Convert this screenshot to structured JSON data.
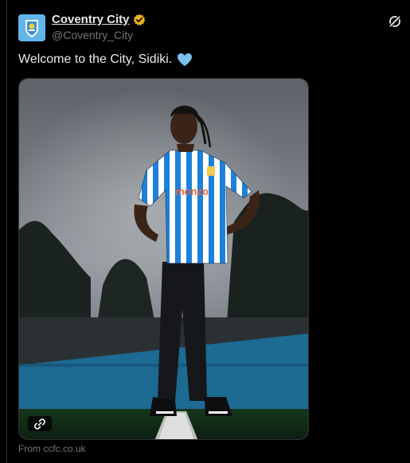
{
  "tweet": {
    "author": {
      "display_name": "Coventry City",
      "handle": "@Coventry_City",
      "verified_badge": "gold-check-badge",
      "avatar": "coventry-city-crest"
    },
    "text": "Welcome to the City, Sidiki.",
    "emoji": "light-blue-heart",
    "media": {
      "description_icon": "link-icon",
      "shirt_sponsor": "monzo"
    },
    "source": "From ccfc.co.uk",
    "action_icon": "grok-icon"
  },
  "colors": {
    "background": "#000000",
    "text_primary": "#e7e9ea",
    "text_secondary": "#71767b",
    "accent_sky_blue": "#1e9be0",
    "heart": "#79bff0",
    "verified": "#e8b21f"
  }
}
